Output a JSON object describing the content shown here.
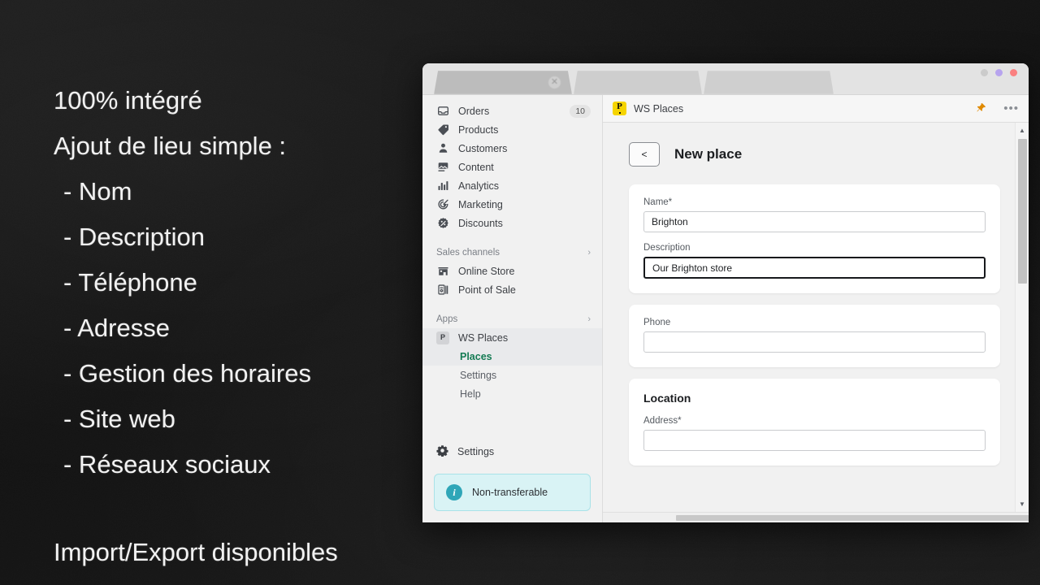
{
  "slide": {
    "headline": "100% intégré",
    "subhead": "Ajout de lieu simple :",
    "bullets": [
      "- Nom",
      "- Description",
      "- Téléphone",
      "- Adresse",
      "- Gestion des horaires",
      "- Site web",
      "- Réseaux sociaux"
    ],
    "footer": "Import/Export disponibles"
  },
  "window": {
    "tabs": [
      {
        "title": "",
        "active": true,
        "close_label": "✕"
      },
      {
        "title": "",
        "active": false
      },
      {
        "title": "",
        "active": false
      }
    ],
    "controls": {
      "minimize": "minimize",
      "maximize": "maximize",
      "close": "close"
    },
    "colors": {
      "minimize": "#cbcbcb",
      "maximize": "#b7a4ee",
      "close": "#fa8080"
    }
  },
  "sidebar": {
    "items": [
      {
        "label": "Orders",
        "icon": "inbox-icon",
        "badge": "10"
      },
      {
        "label": "Products",
        "icon": "tag-icon",
        "badge": ""
      },
      {
        "label": "Customers",
        "icon": "person-icon",
        "badge": ""
      },
      {
        "label": "Content",
        "icon": "content-icon",
        "badge": ""
      },
      {
        "label": "Analytics",
        "icon": "bar-chart-icon",
        "badge": ""
      },
      {
        "label": "Marketing",
        "icon": "marketing-target-icon",
        "badge": ""
      },
      {
        "label": "Discounts",
        "icon": "discount-percent-icon",
        "badge": ""
      }
    ],
    "sales_channels": {
      "title": "Sales channels",
      "chevron": "›",
      "items": [
        {
          "label": "Online Store",
          "icon": "storefront-icon"
        },
        {
          "label": "Point of Sale",
          "icon": "point-of-sale-icon"
        }
      ]
    },
    "apps": {
      "title": "Apps",
      "chevron": "›",
      "app_name": "WS Places",
      "app_icon_letter": "P",
      "sub_items": [
        {
          "label": "Places",
          "active": true
        },
        {
          "label": "Settings",
          "active": false
        },
        {
          "label": "Help",
          "active": false
        }
      ]
    },
    "settings": {
      "label": "Settings",
      "icon": "gear-icon"
    },
    "notice": {
      "text": "Non-transferable",
      "icon": "info-icon",
      "icon_glyph": "i",
      "accent": "#2fa6b8",
      "bg": "#d9f3f5"
    }
  },
  "app_header": {
    "title": "WS Places",
    "logo_letter": "P",
    "logo_color": "#f5d400",
    "pin_icon": "pin-icon",
    "pin_glyph": "📌",
    "more_icon": "more-options-icon",
    "more_glyph": "•••"
  },
  "page": {
    "back_label": "<",
    "title": "New place",
    "cards": [
      {
        "title": "",
        "fields": [
          {
            "label": "Name*",
            "value": "Brighton",
            "placeholder": "",
            "focused": false
          },
          {
            "label": "Description",
            "value": "Our Brighton store",
            "placeholder": "",
            "focused": true
          }
        ]
      },
      {
        "title": "",
        "fields": [
          {
            "label": "Phone",
            "value": "",
            "placeholder": "",
            "focused": false
          }
        ]
      },
      {
        "title": "Location",
        "fields": [
          {
            "label": "Address*",
            "value": "",
            "placeholder": "",
            "focused": false
          }
        ]
      }
    ]
  },
  "scrollbars": {
    "vertical": {
      "up_glyph": "▲",
      "down_glyph": "▼"
    }
  }
}
